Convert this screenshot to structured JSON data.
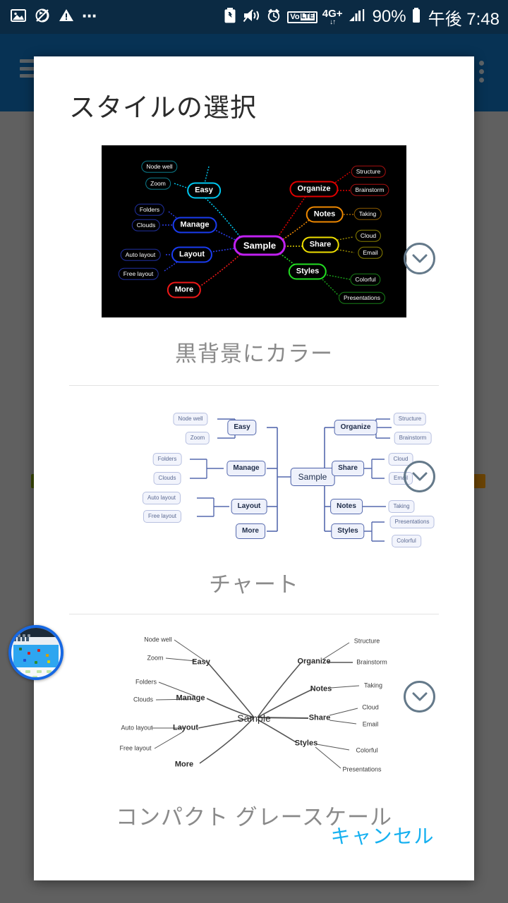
{
  "status_bar": {
    "left_icons": [
      "image-icon",
      "no-sync-icon",
      "warning-icon",
      "more-dots-icon"
    ],
    "right_icons": [
      "battery-saver-icon",
      "vibrate-off-icon",
      "alarm-icon",
      "volte-icon",
      "network-4gplus-icon",
      "signal-bars-icon"
    ],
    "volte_prefix": "Vo",
    "volte_suffix": "LTE",
    "network_label": "4G+",
    "network_arrows": "↓↑",
    "battery_percent": "90%",
    "time": "午後 7:48"
  },
  "app_bar": {
    "menu_icon": "hamburger-icon",
    "overflow_icon": "overflow-menu-icon"
  },
  "floating_icon": {
    "name": "mindmap-app-icon"
  },
  "dialog": {
    "title": "スタイルの選択",
    "cancel_label": "キャンセル",
    "expand_icon": "chevron-down-icon",
    "styles": [
      {
        "id": "dark-color",
        "label": "黒背景にカラー"
      },
      {
        "id": "chart",
        "label": "チャート"
      },
      {
        "id": "compact-grayscale",
        "label": "コンパクト グレースケール"
      }
    ]
  },
  "mindmap": {
    "root": "Sample",
    "branches": [
      {
        "name": "Easy",
        "color": "#00c8f0",
        "leaves": [
          "Node well",
          "Zoom"
        ]
      },
      {
        "name": "Manage",
        "color": "#1a3cf0",
        "leaves": [
          "Folders",
          "Clouds"
        ]
      },
      {
        "name": "Layout",
        "color": "#1a3cf0",
        "leaves": [
          "Auto layout",
          "Free layout"
        ]
      },
      {
        "name": "More",
        "color": "#f01818",
        "leaves": []
      },
      {
        "name": "Organize",
        "color": "#e00000",
        "leaves": [
          "Structure",
          "Brainstorm"
        ]
      },
      {
        "name": "Notes",
        "color": "#ee8800",
        "leaves": [
          "Taking"
        ]
      },
      {
        "name": "Share",
        "color": "#f0e000",
        "leaves": [
          "Cloud",
          "Email"
        ]
      },
      {
        "name": "Styles",
        "color": "#22dd22",
        "leaves": [
          "Colorful",
          "Presentations"
        ]
      }
    ],
    "root_color": "#c020f0",
    "chart_colors": {
      "node_border": "#5569ad",
      "leaf_border": "#b7c0e0",
      "link": "#5569ad"
    },
    "gray_colors": {
      "text": "#2a2a2a",
      "link": "#555555"
    }
  },
  "colors": {
    "status_bar_bg": "#0b2a43",
    "app_bar_bg": "#073254",
    "scrim": "#606060",
    "dialog_bg": "#ffffff",
    "title_text": "#2b2b2b",
    "style_label_text": "#8a8a8a",
    "accent": "#15b0f0",
    "chevron": "#64798a",
    "divider": "#e3e3e3"
  }
}
